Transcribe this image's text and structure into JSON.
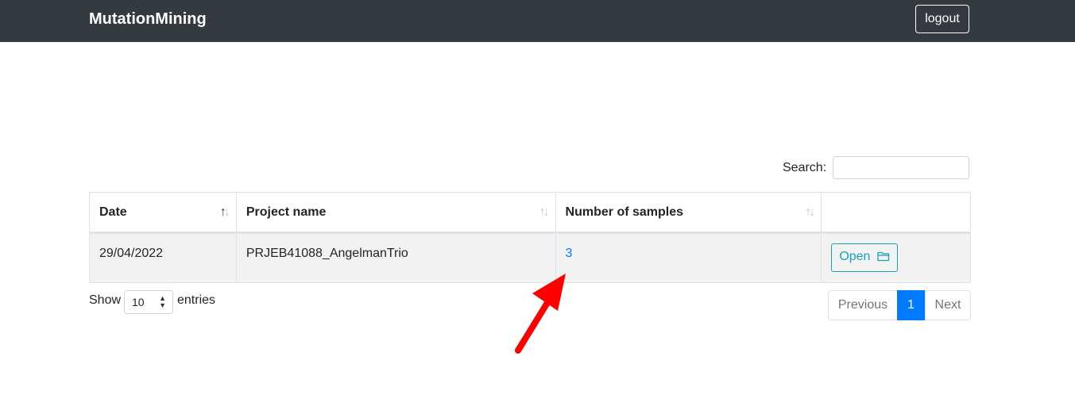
{
  "navbar": {
    "brand": "MutationMining",
    "logout_label": "logout"
  },
  "search": {
    "label": "Search:",
    "value": "",
    "placeholder": ""
  },
  "table": {
    "headers": [
      "Date",
      "Project name",
      "Number of samples",
      ""
    ],
    "rows": [
      {
        "date": "29/04/2022",
        "project_name": "PRJEB41088_AngelmanTrio",
        "num_samples": "3",
        "action_label": "Open"
      }
    ]
  },
  "length_menu": {
    "label_before": "Show",
    "selected": "10",
    "label_after": "entries"
  },
  "pagination": {
    "previous": "Previous",
    "current": "1",
    "next": "Next"
  },
  "colors": {
    "navbar_bg": "#343a40",
    "link": "#007bff",
    "open_button": "#17a2b8",
    "active_page": "#007bff",
    "annotation_arrow": "#ff0000"
  },
  "icons": {
    "sort": "sort-arrows-icon",
    "open": "folder-icon",
    "select": "select-caret-icon",
    "annotation": "red-arrow-icon"
  }
}
